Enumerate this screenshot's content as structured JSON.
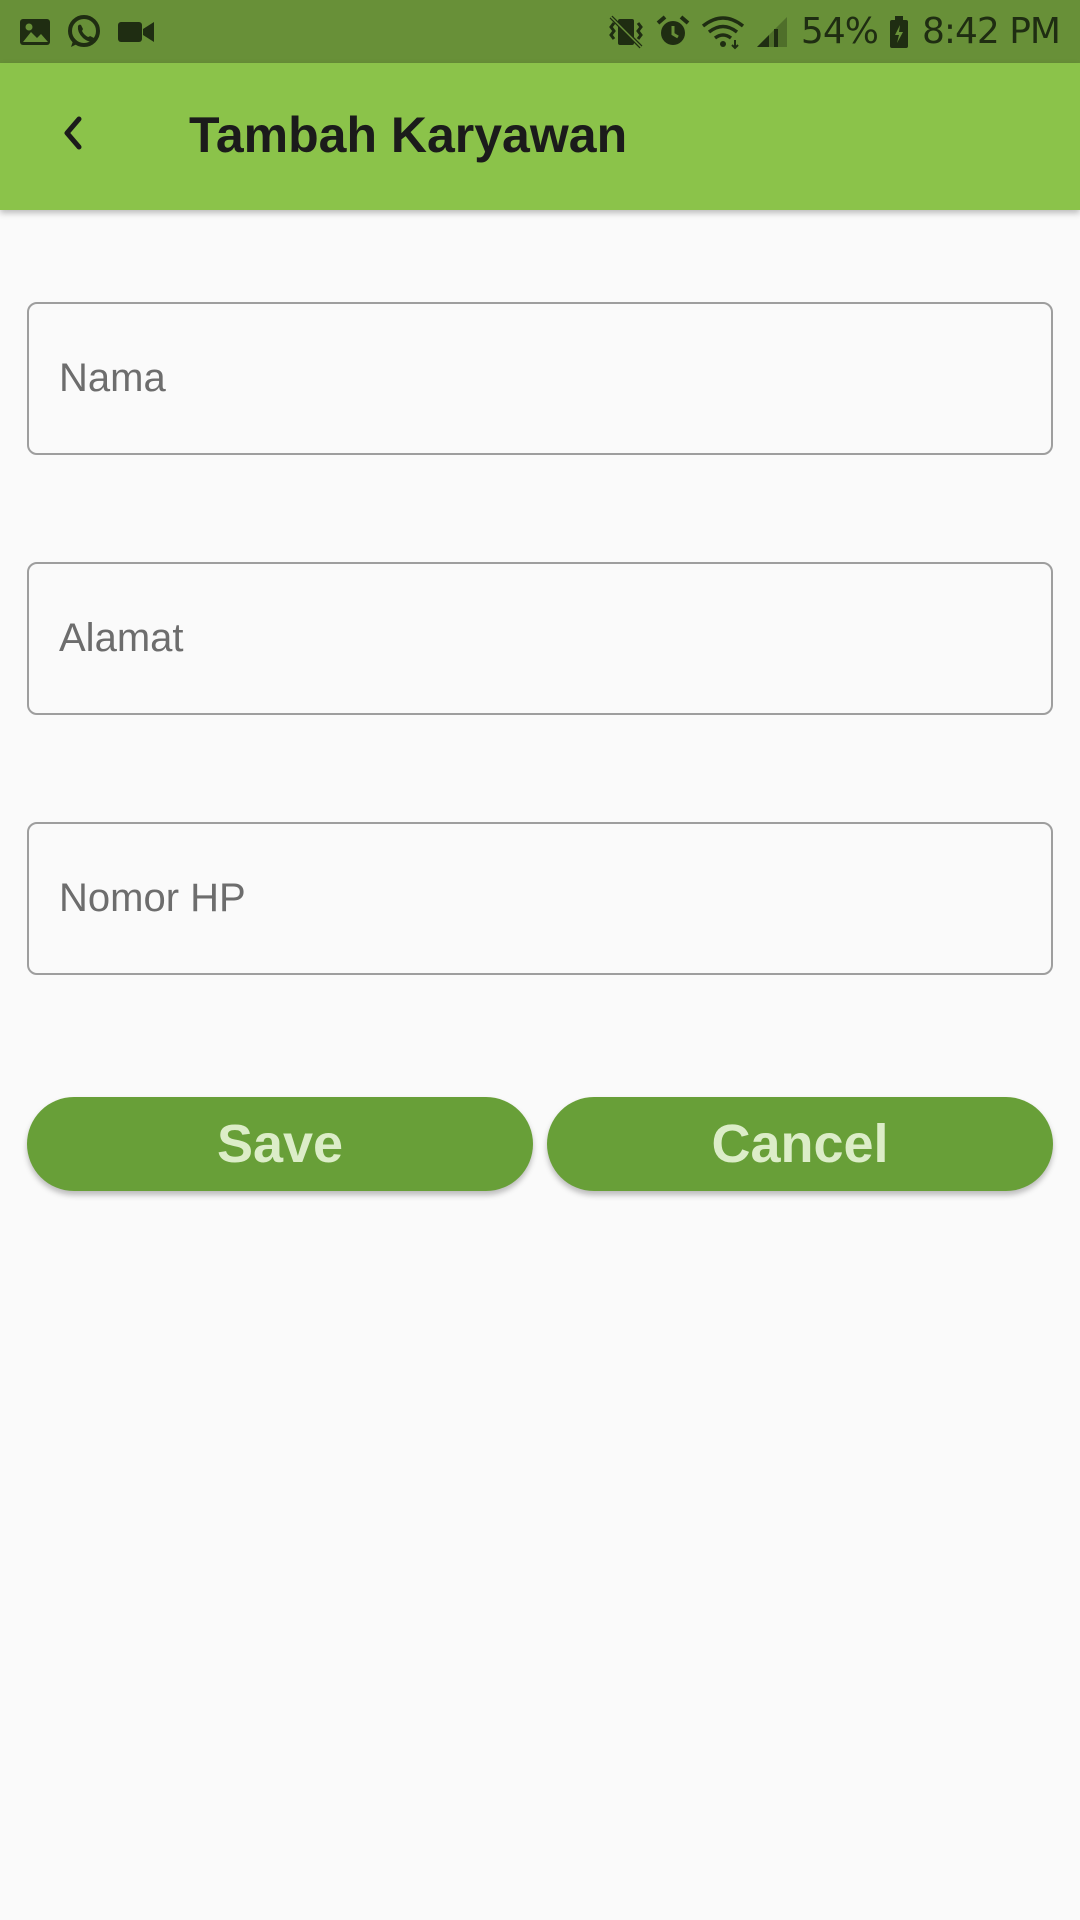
{
  "status_bar": {
    "left_icons": [
      "gallery-icon",
      "whatsapp-icon",
      "video-camera-icon"
    ],
    "right_icons": [
      "vibrate-icon",
      "alarm-icon",
      "wifi-icon",
      "signal-icon",
      "battery-icon"
    ],
    "battery": "54%",
    "time": "8:42 PM"
  },
  "app_bar": {
    "title": "Tambah Karyawan",
    "back_icon": "chevron-left-icon",
    "background": "#8bc34a"
  },
  "form": {
    "fields": [
      {
        "placeholder": "Nama",
        "value": ""
      },
      {
        "placeholder": "Alamat",
        "value": ""
      },
      {
        "placeholder": "Nomor HP",
        "value": ""
      }
    ],
    "save_label": "Save",
    "cancel_label": "Cancel",
    "button_color": "#689f38",
    "button_text_color": "#dcedc8"
  }
}
